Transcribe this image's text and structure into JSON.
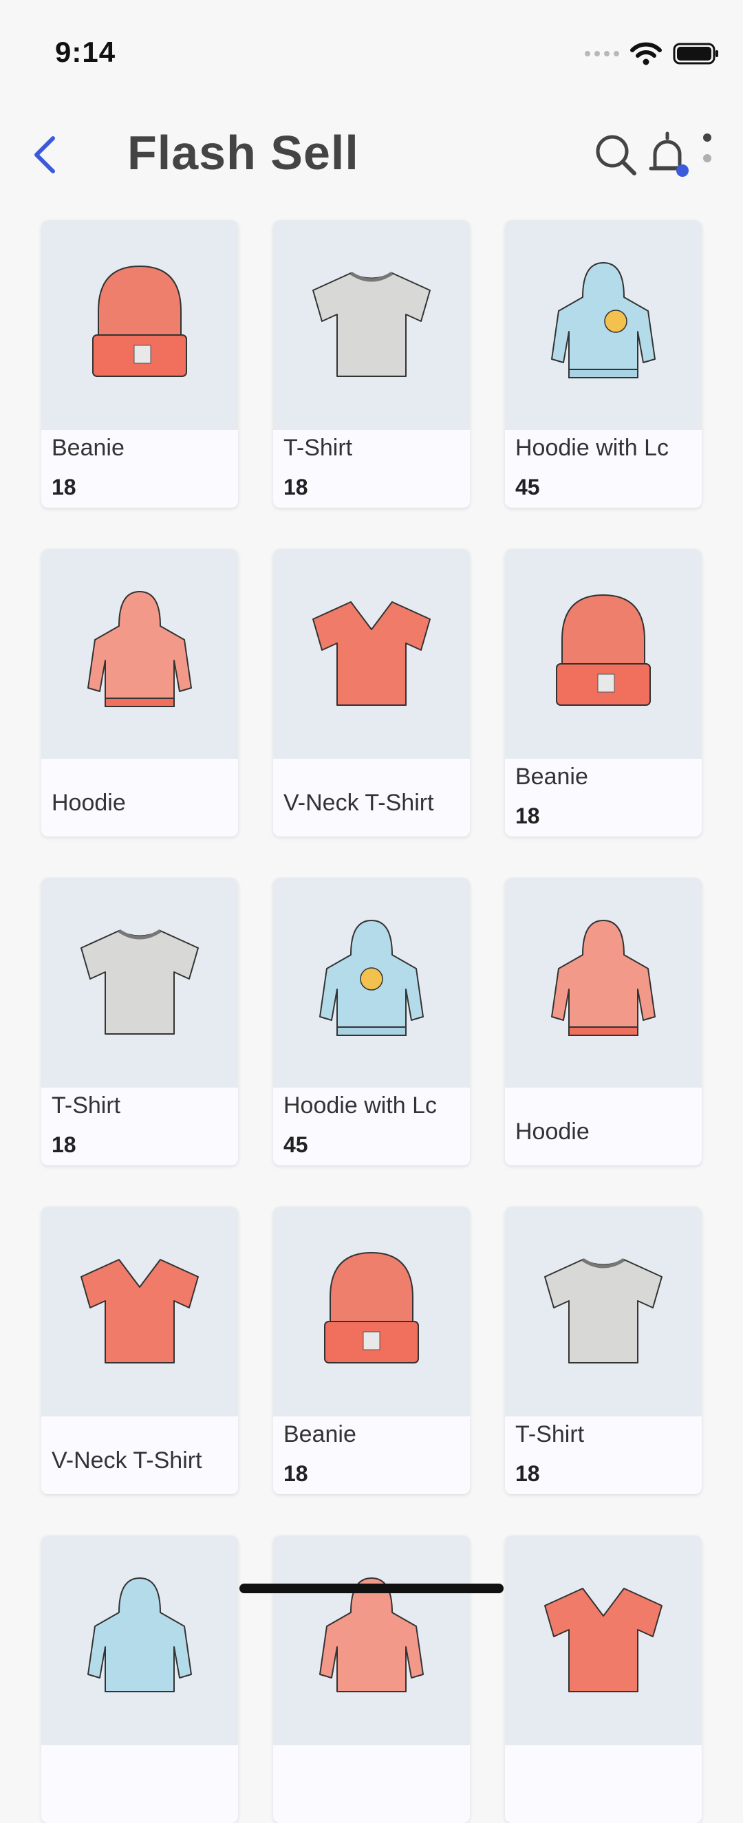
{
  "status": {
    "time": "9:14"
  },
  "header": {
    "title": "Flash Sell"
  },
  "colors": {
    "accent": "#3b5bdb",
    "notification_dot": "#3b5bdb"
  },
  "icons": [
    "back-arrow-icon",
    "search-icon",
    "bell-icon",
    "more-vertical-icon",
    "wifi-icon",
    "battery-icon",
    "signal-icon"
  ],
  "products": [
    {
      "name": "Beanie",
      "price": "18",
      "image": "beanie-red"
    },
    {
      "name": "T-Shirt",
      "price": "18",
      "image": "tshirt-gray"
    },
    {
      "name": "Hoodie with Lc",
      "price": "45",
      "image": "hoodie-blue"
    },
    {
      "name": "Hoodie",
      "price": "",
      "image": "hoodie-red"
    },
    {
      "name": "V-Neck T-Shirt",
      "price": "",
      "image": "vneck-red"
    },
    {
      "name": "Beanie",
      "price": "18",
      "image": "beanie-red"
    },
    {
      "name": "T-Shirt",
      "price": "18",
      "image": "tshirt-gray"
    },
    {
      "name": "Hoodie with Lc",
      "price": "45",
      "image": "hoodie-blue"
    },
    {
      "name": "Hoodie",
      "price": "",
      "image": "hoodie-red"
    },
    {
      "name": "V-Neck T-Shirt",
      "price": "",
      "image": "vneck-red"
    },
    {
      "name": "Beanie",
      "price": "18",
      "image": "beanie-red"
    },
    {
      "name": "T-Shirt",
      "price": "18",
      "image": "tshirt-gray"
    }
  ]
}
